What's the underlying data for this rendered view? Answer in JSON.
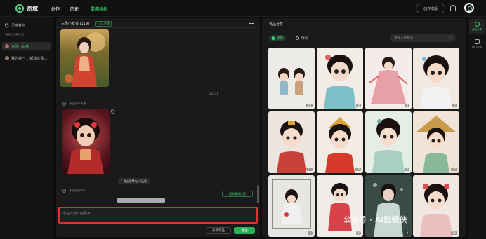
{
  "header": {
    "brand": "奇域",
    "nav": [
      "创作",
      "历史",
      "灵感共创"
    ],
    "create_button": "创作本版"
  },
  "sidebar": {
    "top_item": "灵感共创",
    "section_label": "我的灵感共创",
    "items": [
      "古风小女孩",
      "我的第一....纸球衣系..."
    ]
  },
  "chat": {
    "title": "古风小女孩 (119)",
    "badge": "• 4人在线",
    "time": "21:01",
    "user1": "寻宝家7c9yfk",
    "chip": "1  寻宝家Msgu3还原",
    "user2": "寻宝家ga79c",
    "back_button": "回到最新位置",
    "input_placeholder": "请在此处开始聊天",
    "share_button": "分享作品",
    "send_button": "发送"
  },
  "gallery": {
    "title": "作品分享",
    "filter_hot": "点赞",
    "filter_time": "时间",
    "search_placeholder": "请输入搜索词",
    "counts": [
      "10",
      "8",
      "9",
      "7",
      "11",
      "14",
      "9",
      "12",
      "6",
      "5",
      "8",
      "10"
    ]
  },
  "rail": {
    "share": "作品分享",
    "chat": "热门共创"
  },
  "watermark": "公众号 · AI肚铁侠",
  "colors": {
    "accent": "#3ecf6e",
    "highlight": "#e0332f"
  }
}
